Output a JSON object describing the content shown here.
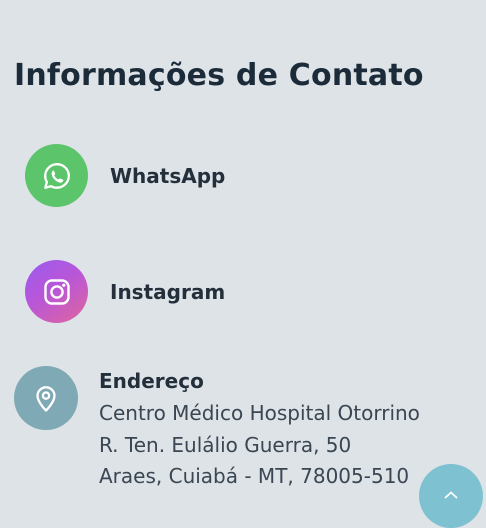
{
  "section": {
    "title": "Informações de Contato"
  },
  "contacts": [
    {
      "label": "WhatsApp",
      "icon": "whatsapp-icon",
      "color": "#5cc46a"
    },
    {
      "label": "Instagram",
      "icon": "instagram-icon",
      "color": "#b856d8"
    }
  ],
  "address": {
    "icon": "map-pin-icon",
    "heading": "Endereço",
    "lines": [
      "Centro Médico Hospital Otorrino",
      "R. Ten. Eulálio Guerra, 50",
      "Araes, Cuiabá - MT, 78005-510"
    ],
    "color": "#7fa9b4"
  },
  "back_to_top": {
    "icon": "chevron-up-icon",
    "color": "#7ec1d1"
  }
}
